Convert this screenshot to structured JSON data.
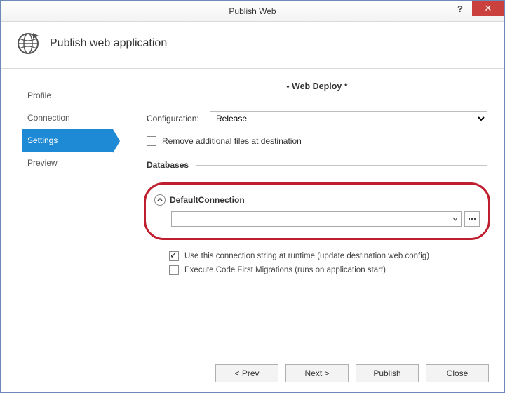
{
  "window": {
    "title": "Publish Web"
  },
  "header": {
    "title": "Publish web application"
  },
  "sidebar": {
    "items": [
      {
        "label": "Profile"
      },
      {
        "label": "Connection"
      },
      {
        "label": "Settings"
      },
      {
        "label": "Preview"
      }
    ]
  },
  "main": {
    "deploy_title": "- Web Deploy *",
    "config_label": "Configuration:",
    "config_value": "Release",
    "remove_files_label": "Remove additional files at destination",
    "db_section": "Databases",
    "db_name": "DefaultConnection",
    "use_conn_label": "Use this connection string at runtime (update destination web.config)",
    "migrations_label": "Execute Code First Migrations (runs on application start)"
  },
  "footer": {
    "prev": "<  Prev",
    "next": "Next  >",
    "publish": "Publish",
    "close": "Close"
  }
}
